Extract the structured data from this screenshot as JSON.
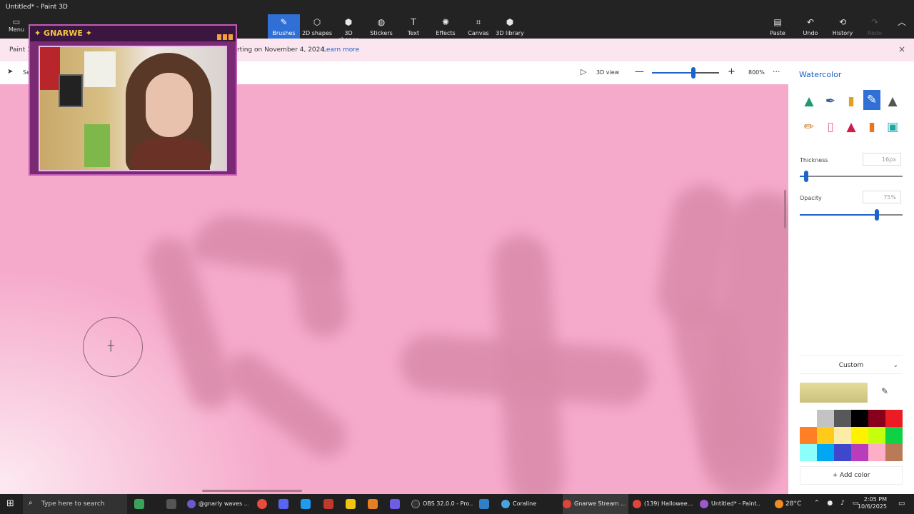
{
  "window": {
    "title": "Untitled* - Paint 3D"
  },
  "toolbar": {
    "menu": "Menu",
    "tools": [
      {
        "label": "Brushes",
        "icon": "brush-icon",
        "glyph": "✎"
      },
      {
        "label": "2D shapes",
        "icon": "2d-shapes-icon",
        "glyph": "⬡"
      },
      {
        "label": "3D shapes",
        "icon": "3d-shapes-icon",
        "glyph": "⬢"
      },
      {
        "label": "Stickers",
        "icon": "stickers-icon",
        "glyph": "◍"
      },
      {
        "label": "Text",
        "icon": "text-icon",
        "glyph": "T"
      },
      {
        "label": "Effects",
        "icon": "effects-icon",
        "glyph": "✺"
      },
      {
        "label": "Canvas",
        "icon": "canvas-icon",
        "glyph": "⌗"
      },
      {
        "label": "3D library",
        "icon": "3d-library-icon",
        "glyph": "⬢"
      }
    ],
    "right": [
      {
        "label": "Paste",
        "icon": "paste-icon",
        "glyph": "▤"
      },
      {
        "label": "Undo",
        "icon": "undo-icon",
        "glyph": "↶"
      },
      {
        "label": "History",
        "icon": "history-icon",
        "glyph": "⟲"
      },
      {
        "label": "Redo",
        "icon": "redo-icon",
        "glyph": "↷"
      }
    ],
    "collapse_glyph": "︿"
  },
  "notice": {
    "app": "Paint 3",
    "text": "rting on November 4, 2024.",
    "link": "Learn more",
    "close": "×"
  },
  "viewbar": {
    "select_label": "Se",
    "view3d": "3D view",
    "zoom_minus": "—",
    "zoom_plus": "+",
    "zoom_value": "800%",
    "zoom_level": 0.62,
    "more": "···"
  },
  "panel": {
    "title": "Watercolor",
    "brushes": [
      "marker",
      "calligraphy-pen",
      "oil-brush",
      "watercolor",
      "pixel-pen",
      "pencil",
      "eraser",
      "crayon",
      "spray-can",
      "fill"
    ],
    "selected_brush": 3,
    "thickness_label": "Thickness",
    "thickness_value": "16px",
    "thickness_level": 0.06,
    "opacity_label": "Opacity",
    "opacity_value": "75%",
    "opacity_level": 0.75,
    "color_mode": "Custom",
    "current_color": "#e6dc9a",
    "palette": [
      "#ffffff",
      "#c3c3c3",
      "#585858",
      "#000000",
      "#88001b",
      "#ec1c24",
      "#ff7f27",
      "#ffca18",
      "#fdeca6",
      "#fff200",
      "#c4ff0e",
      "#0ed145",
      "#8cfffb",
      "#00a8f3",
      "#3f48cc",
      "#b83dba",
      "#ffaec8",
      "#b97a57"
    ],
    "add_color": "Add color"
  },
  "webcam": {
    "title": "✦ GNARWE ✦"
  },
  "taskbar": {
    "search_placeholder": "Type here to search",
    "apps": [
      {
        "label": "@gnarly waves ...",
        "color": "#6a5acd"
      },
      {
        "label": "OBS 32.0.0 - Pro...",
        "color": "#333333"
      },
      {
        "label": "Coraline",
        "color": "#4aa3df"
      },
      {
        "label": "Gnarwe Stream ...",
        "color": "#e0443a"
      },
      {
        "label": "(139) Hallowee...",
        "color": "#e0443a"
      },
      {
        "label": "Untitled* - Paint...",
        "color": "#9b59d0"
      }
    ],
    "temperature": "28°C",
    "time": "2:05 PM",
    "date": "10/6/2025"
  }
}
